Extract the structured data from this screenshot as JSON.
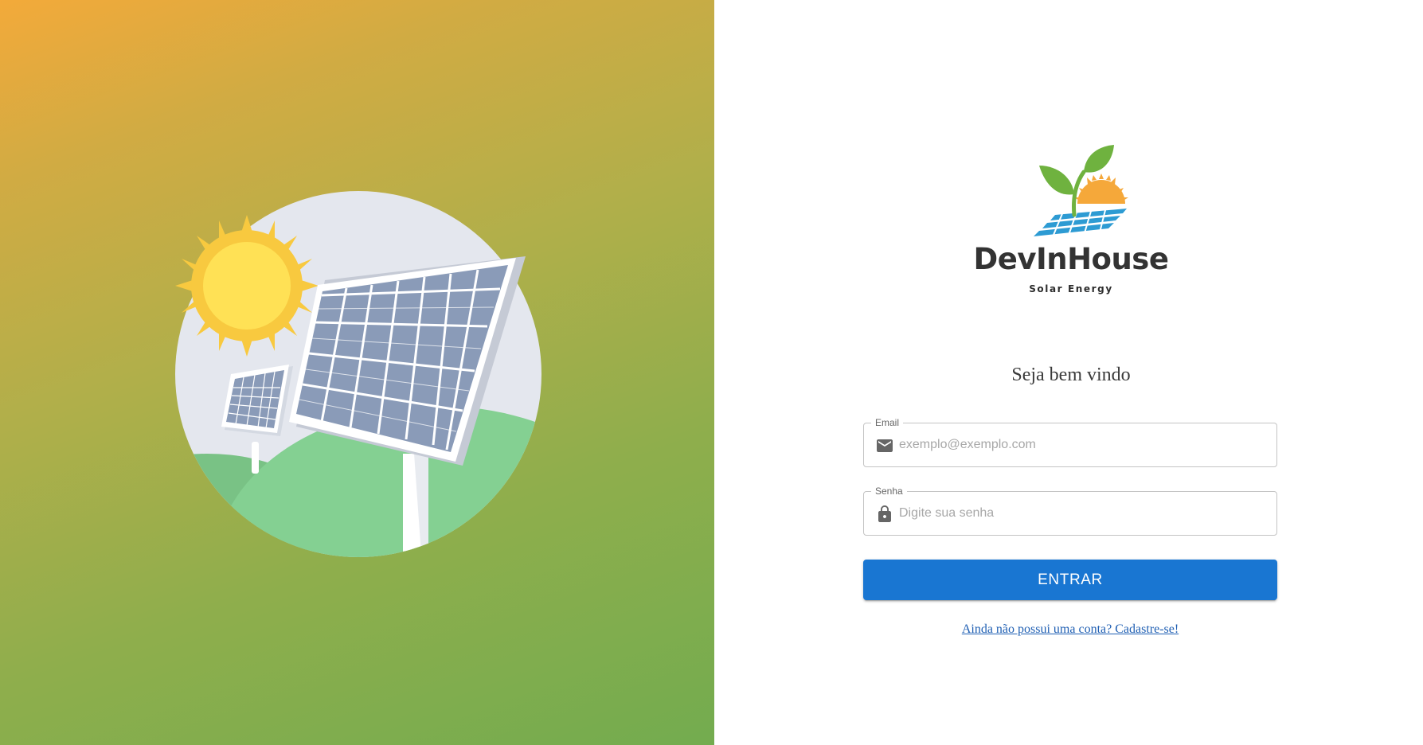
{
  "illustration": {
    "name": "solar-panels-illustration",
    "colors": {
      "sky": "#e4e7ee",
      "sun": "#ffe155",
      "sun_rays": "#f8c93f",
      "hill_light": "#84d092",
      "hill_dark": "#79c285",
      "panel_cell": "#8a9bb8",
      "panel_frame": "#ffffff"
    }
  },
  "brand": {
    "name": "DevInHouse",
    "tagline": "Solar Energy",
    "logo_icon": "leaf-sun-solar-panel-logo",
    "colors": {
      "leaf": "#6fb23f",
      "sun": "#f5a83a",
      "panel": "#2d9bd3"
    }
  },
  "login": {
    "welcome": "Seja bem vindo",
    "email": {
      "label": "Email",
      "placeholder": "exemplo@exemplo.com",
      "value": "",
      "icon": "mail-icon"
    },
    "password": {
      "label": "Senha",
      "placeholder": "Digite sua senha",
      "value": "",
      "icon": "lock-icon"
    },
    "submit_label": "ENTRAR",
    "signup_link": "Ainda não possui uma conta? Cadastre-se!"
  },
  "colors": {
    "primary": "#1976d2",
    "link": "#1f5fb3",
    "gradient_start": "#f3aa3a",
    "gradient_end": "#73ac4f"
  }
}
